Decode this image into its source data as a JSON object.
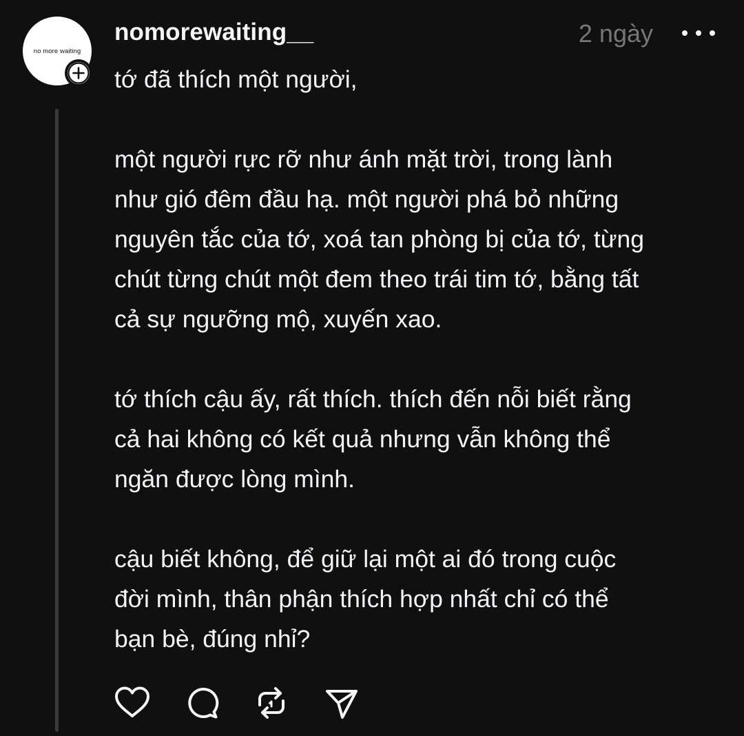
{
  "post": {
    "avatar_text": "no more waiting",
    "username": "nomorewaiting__",
    "timestamp": "2 ngày",
    "paragraphs": [
      [
        "tớ đã thích một người,"
      ],
      [
        "một người rực rỡ như ánh mặt trời, trong lành",
        "như gió đêm đầu hạ. một người phá bỏ những",
        "nguyên tắc của tớ, xoá tan phòng bị của tớ, từng",
        "chút từng chút một đem theo trái tim tớ, bằng tất",
        "cả sự ngưỡng mộ, xuyến xao."
      ],
      [
        "tớ thích cậu ấy, rất thích. thích đến nỗi biết rằng",
        "cả hai không có kết quả nhưng vẫn không thể",
        "ngăn được lòng mình."
      ],
      [
        "cậu biết không, để giữ lại một ai đó trong cuộc",
        "đời mình, thân phận thích hợp nhất chỉ có thể",
        "bạn bè, đúng nhỉ?"
      ]
    ]
  },
  "icons": {
    "follow": "plus-icon",
    "more": "more-horizontal-icon",
    "like": "heart-icon",
    "reply": "comment-icon",
    "repost": "repost-icon",
    "share": "send-icon"
  },
  "colors": {
    "background": "#101010",
    "text": "#f3f5f7",
    "secondary_text": "#777777",
    "thread_line": "#3a3a3a"
  }
}
